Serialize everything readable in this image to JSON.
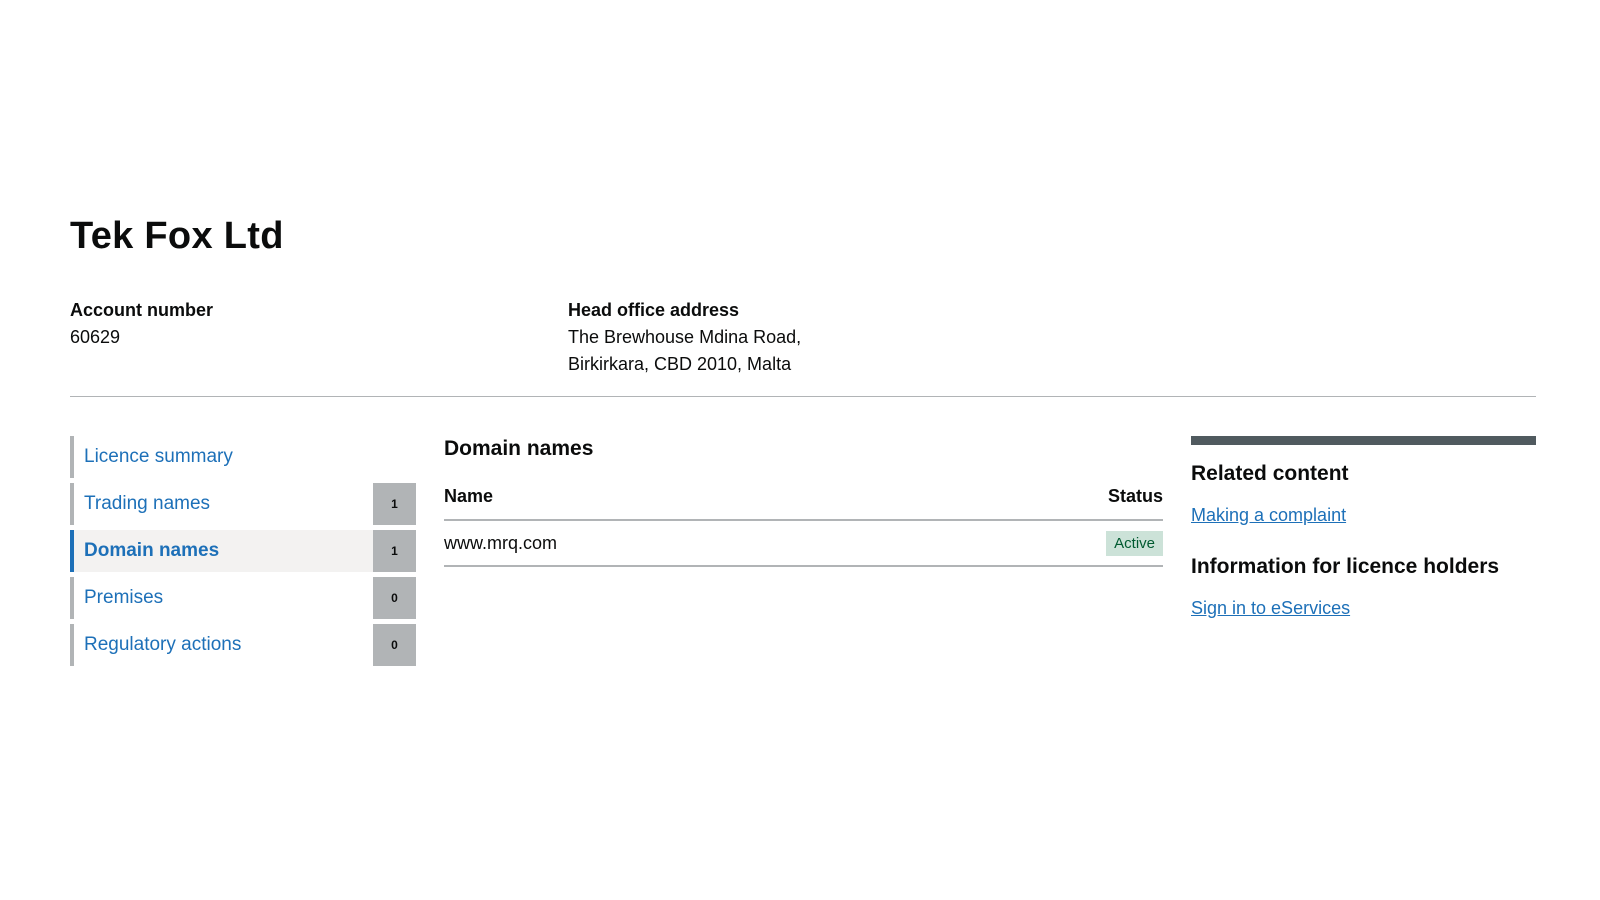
{
  "header": {
    "title": "Tek Fox Ltd",
    "account_label": "Account number",
    "account_value": "60629",
    "address_label": "Head office address",
    "address_line1": "The Brewhouse Mdina Road,",
    "address_line2": "Birkirkara, CBD 2010, Malta"
  },
  "sidenav": {
    "items": [
      {
        "label": "Licence summary",
        "count": null,
        "active": false
      },
      {
        "label": "Trading names",
        "count": "1",
        "active": false
      },
      {
        "label": "Domain names",
        "count": "1",
        "active": true
      },
      {
        "label": "Premises",
        "count": "0",
        "active": false
      },
      {
        "label": "Regulatory actions",
        "count": "0",
        "active": false
      }
    ]
  },
  "main": {
    "heading": "Domain names",
    "table": {
      "columns": [
        "Name",
        "Status"
      ],
      "rows": [
        {
          "name": "www.mrq.com",
          "status": "Active"
        }
      ]
    }
  },
  "aside": {
    "related_heading": "Related content",
    "related_link": "Making a complaint",
    "holders_heading": "Information for licence holders",
    "holders_link": "Sign in to eServices"
  },
  "colors": {
    "link": "#1d70b8",
    "active_tag_bg": "#cce2d8",
    "active_tag_text": "#005a30",
    "count_bg": "#b1b4b6",
    "aside_bar": "#505a5f"
  }
}
